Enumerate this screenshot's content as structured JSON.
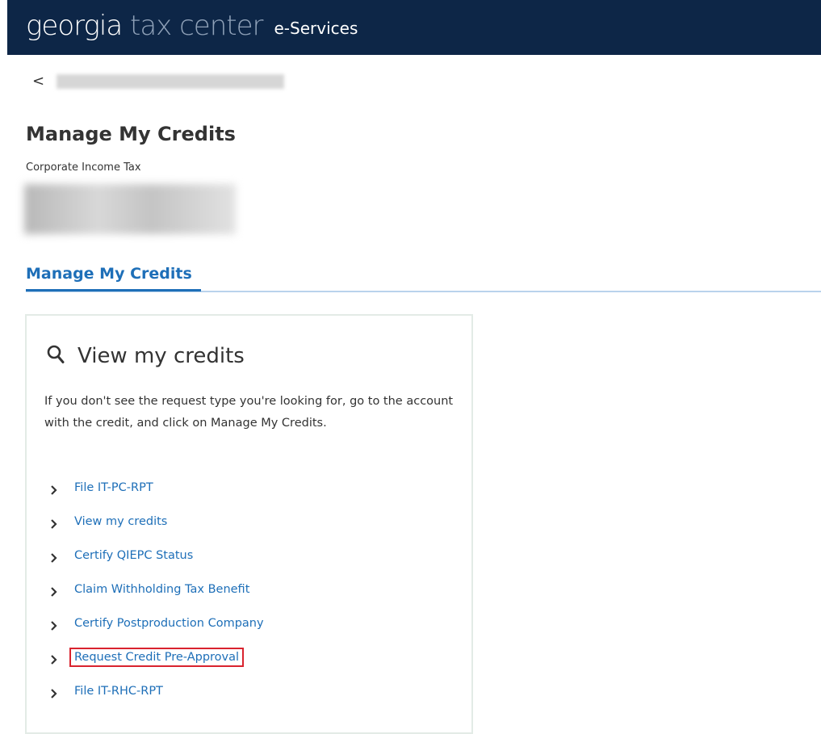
{
  "header": {
    "brand_dark": "georgia",
    "brand_light": "tax center",
    "service": "e-Services",
    "colors": {
      "background": "#0d2647",
      "brand_light": "#8fa1b8"
    }
  },
  "nav": {
    "back_glyph": "<"
  },
  "page": {
    "title": "Manage My Credits",
    "subtitle": "Corporate Income Tax"
  },
  "tabs": [
    {
      "label": "Manage My Credits",
      "active": true
    }
  ],
  "card": {
    "icon": "search-icon",
    "title": "View my credits",
    "description": "If you don't see the request type you're looking for, go to the account with the credit, and click on Manage My Credits.",
    "links": [
      {
        "label": "File IT-PC-RPT",
        "highlighted": false
      },
      {
        "label": "View my credits",
        "highlighted": false
      },
      {
        "label": "Certify QIEPC Status",
        "highlighted": false
      },
      {
        "label": "Claim Withholding Tax Benefit",
        "highlighted": false
      },
      {
        "label": "Certify Postproduction Company",
        "highlighted": false
      },
      {
        "label": "Request Credit Pre-Approval",
        "highlighted": true
      },
      {
        "label": "File IT-RHC-RPT",
        "highlighted": false
      }
    ]
  },
  "colors": {
    "link": "#1e6fb8",
    "highlight_border": "#d9232e",
    "tab_rule": "#b9d3ec"
  }
}
